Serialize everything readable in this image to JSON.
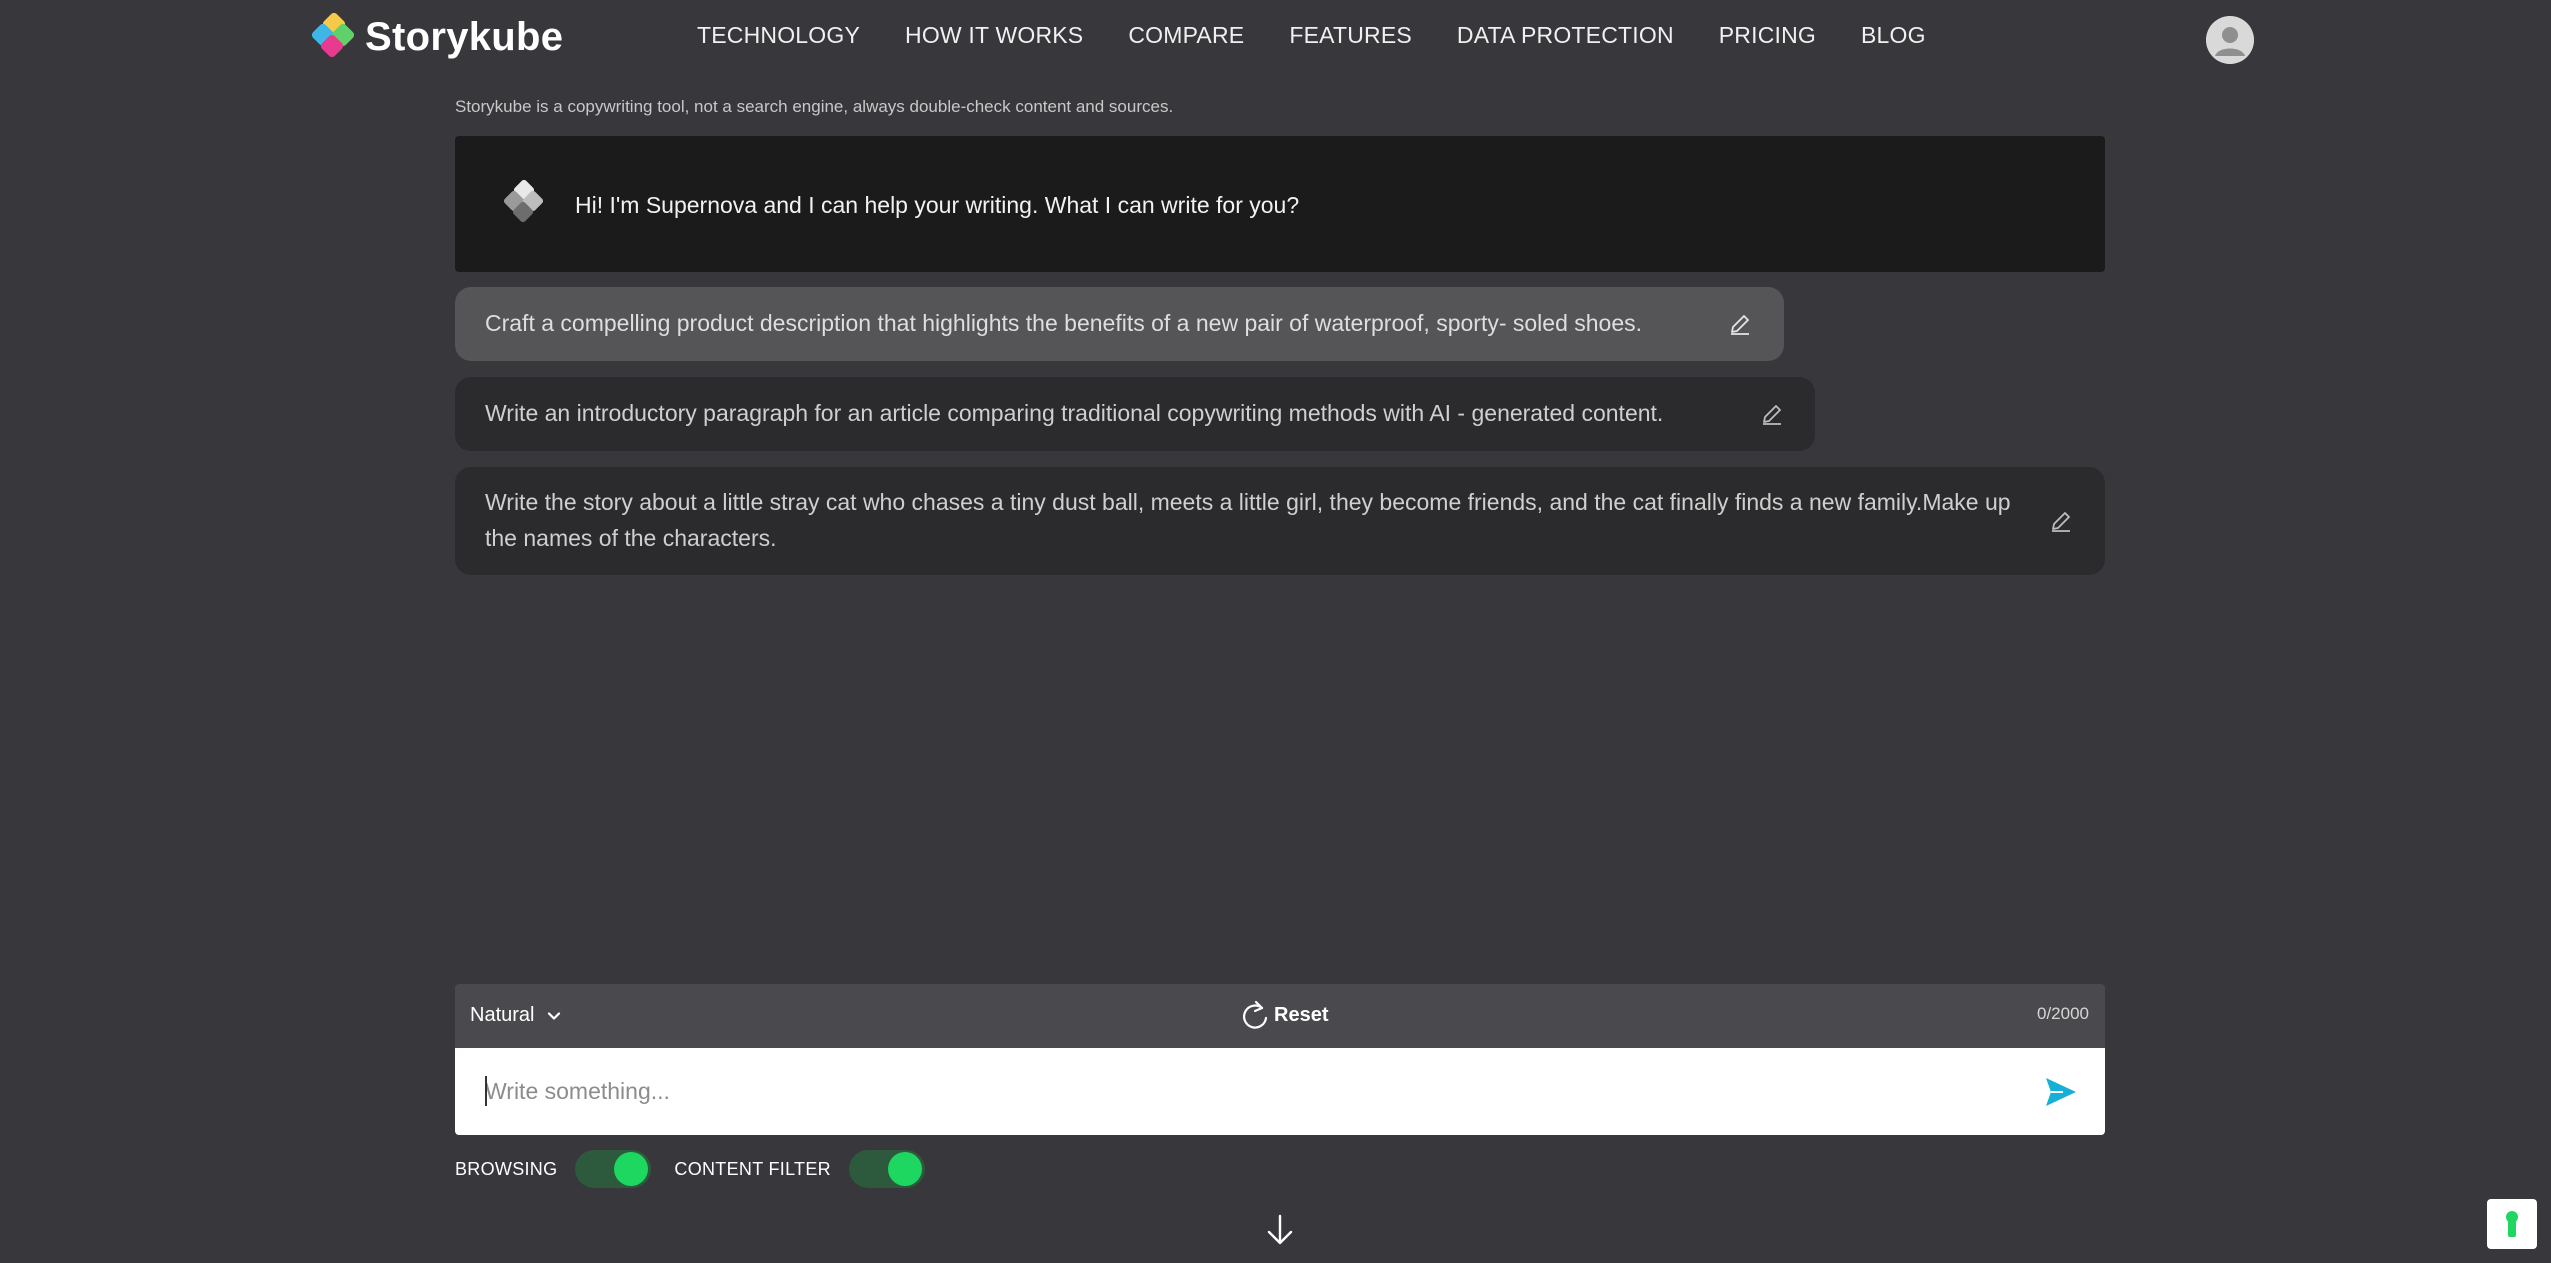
{
  "brand": {
    "name": "Storykube"
  },
  "nav": [
    {
      "label": "TECHNOLOGY"
    },
    {
      "label": "HOW IT WORKS"
    },
    {
      "label": "COMPARE"
    },
    {
      "label": "FEATURES"
    },
    {
      "label": "DATA PROTECTION"
    },
    {
      "label": "PRICING"
    },
    {
      "label": "BLOG"
    }
  ],
  "disclaimer": "Storykube is a copywriting tool, not a search engine, always double-check content and sources.",
  "greeting": "Hi! I'm Supernova and I can help your writing. What I can write for you?",
  "suggestions": [
    {
      "text": "Craft a compelling product description that highlights the benefits of a new pair of waterproof, sporty- soled shoes."
    },
    {
      "text": "Write an introductory paragraph for an article comparing traditional copywriting methods with AI - generated content."
    },
    {
      "text": "Write the story about a little stray cat who chases a tiny dust ball, meets a little girl, they become friends, and the cat finally finds a new family.Make up the names of the characters."
    }
  ],
  "toolbar": {
    "mode": "Natural",
    "reset_label": "Reset",
    "counter": "0/2000"
  },
  "input": {
    "placeholder": "Write something..."
  },
  "toggles": {
    "browsing_label": "BROWSING",
    "browsing_on": true,
    "content_filter_label": "CONTENT FILTER",
    "content_filter_on": true
  },
  "colors": {
    "background": "#38373b",
    "toggle_on": "#1ed760",
    "send": "#16b0d6"
  }
}
